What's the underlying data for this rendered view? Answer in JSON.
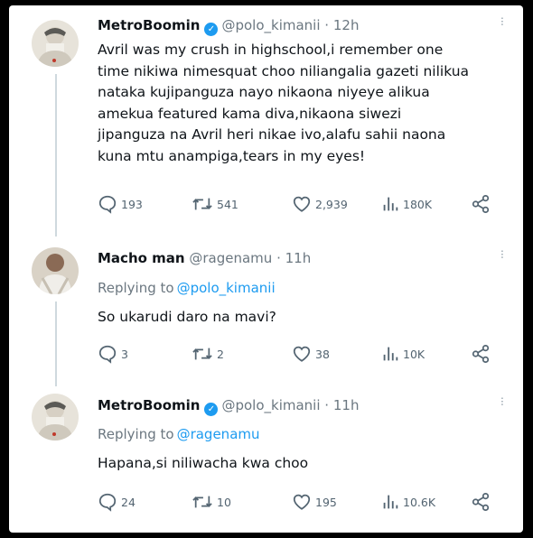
{
  "tweets": [
    {
      "name": "MetroBoomin",
      "handle": "@polo_kimanii",
      "sep": "·",
      "time": "12h",
      "lines": [
        "Avril was my crush in highschool,i remember one",
        "time nikiwa nimesquat choo niliangalia gazeti nilikua",
        "nataka kujipanguza nayo nikaona niyeye alikua",
        "amekua featured  kama diva,nikaona siwezi",
        "jipanguza na Avril heri nikae ivo,alafu sahii naona",
        "kuna mtu anampiga,tears in my eyes!"
      ],
      "replies": "193",
      "retweets": "541",
      "likes": "2,939",
      "views": "180K"
    },
    {
      "name": "Macho man",
      "handle": "@ragenamu",
      "sep": "·",
      "time": "11h",
      "replying_label": "Replying to",
      "replying_to": "@polo_kimanii",
      "lines": [
        "So ukarudi daro na mavi?"
      ],
      "replies": "3",
      "retweets": "2",
      "likes": "38",
      "views": "10K"
    },
    {
      "name": "MetroBoomin",
      "handle": "@polo_kimanii",
      "sep": "·",
      "time": "11h",
      "replying_label": "Replying to",
      "replying_to": "@ragenamu",
      "lines": [
        "Hapana,si niliwacha kwa choo"
      ],
      "replies": "24",
      "retweets": "10",
      "likes": "195",
      "views": "10.6K"
    }
  ],
  "icons": {
    "verified": "verified-badge-icon",
    "reply": "reply-icon",
    "retweet": "retweet-icon",
    "like": "heart-icon",
    "views": "views-icon",
    "share": "share-icon",
    "more": "more-icon"
  },
  "colors": {
    "accent": "#1d9bf0",
    "text": "#0f1419",
    "muted": "#536471",
    "background": "#ffffff",
    "frame": "#000000"
  }
}
